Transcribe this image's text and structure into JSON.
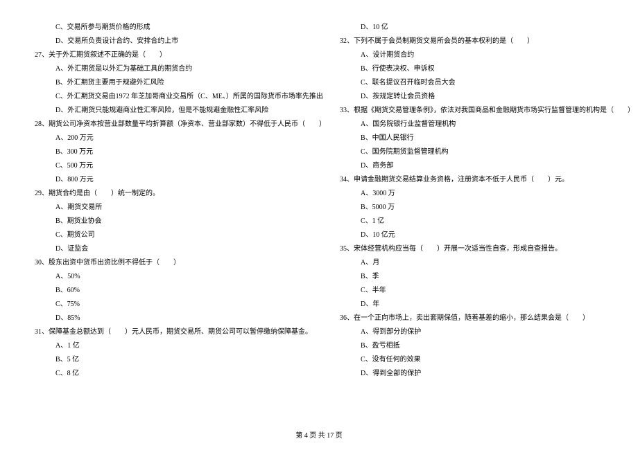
{
  "left_lines": [
    {
      "cls": "opt-indent",
      "text": "C、交易所参与期货价格的形成"
    },
    {
      "cls": "opt-indent",
      "text": "D、交易所负责设计合约、安排合约上市"
    },
    {
      "cls": "q-indent",
      "text": "27、关于外汇期货叙述不正确的是（　　）"
    },
    {
      "cls": "opt-indent",
      "text": "A、外汇期货是以外汇为基础工具的期货合约"
    },
    {
      "cls": "opt-indent",
      "text": "B、外汇期货主要用于规避外汇风险"
    },
    {
      "cls": "opt-indent",
      "text": "C、外汇期货交易由1972 年芝加哥商业交易所（C、ME、）所属的国际货币市场率先推出"
    },
    {
      "cls": "opt-indent",
      "text": "D、外汇期货只能规避商业性汇率风险，但是不能规避金融性汇率风险"
    },
    {
      "cls": "q-indent",
      "text": "28、期货公司净资本按营业部数量平均折算额（净资本、营业部家数）不得低于人民币（　　）"
    },
    {
      "cls": "opt-indent",
      "text": "A、200 万元"
    },
    {
      "cls": "opt-indent",
      "text": "B、300 万元"
    },
    {
      "cls": "opt-indent",
      "text": "C、500 万元"
    },
    {
      "cls": "opt-indent",
      "text": "D、800 万元"
    },
    {
      "cls": "q-indent",
      "text": "29、期货合约是由（　　）统一制定的。"
    },
    {
      "cls": "opt-indent",
      "text": "A、期货交易所"
    },
    {
      "cls": "opt-indent",
      "text": "B、期货业协会"
    },
    {
      "cls": "opt-indent",
      "text": "C、期货公司"
    },
    {
      "cls": "opt-indent",
      "text": "D、证监会"
    },
    {
      "cls": "q-indent",
      "text": "30、股东出资中货币出资比例不得低于（　　）"
    },
    {
      "cls": "opt-indent",
      "text": "A、50%"
    },
    {
      "cls": "opt-indent",
      "text": "B、60%"
    },
    {
      "cls": "opt-indent",
      "text": "C、75%"
    },
    {
      "cls": "opt-indent",
      "text": "D、85%"
    },
    {
      "cls": "q-indent",
      "text": "31、保障基金总额达到（　　）元人民币，期货交易所、期货公司可以暂停缴纳保障基金。"
    },
    {
      "cls": "opt-indent",
      "text": "A、1 亿"
    },
    {
      "cls": "opt-indent",
      "text": "B、5 亿"
    },
    {
      "cls": "opt-indent",
      "text": "C、8 亿"
    }
  ],
  "right_lines": [
    {
      "cls": "opt-indent",
      "text": "D、10 亿"
    },
    {
      "cls": "q-indent",
      "text": "32、下列不属于会员制期货交易所会员的基本权利的是（　　）"
    },
    {
      "cls": "opt-indent",
      "text": "A、设计期货合约"
    },
    {
      "cls": "opt-indent",
      "text": "B、行使表决权、申诉权"
    },
    {
      "cls": "opt-indent",
      "text": "C、联名提议召开临时会员大会"
    },
    {
      "cls": "opt-indent",
      "text": "D、按规定转让会员资格"
    },
    {
      "cls": "q-indent",
      "text": "33、根据《期货交易管理条例》，依法对我国商品和金融期货市场实行监督管理的机构是（　　）"
    },
    {
      "cls": "opt-indent",
      "text": "A、国务院银行业监督管理机构"
    },
    {
      "cls": "opt-indent",
      "text": "B、中国人民银行"
    },
    {
      "cls": "opt-indent",
      "text": "C、国务院期货监督管理机构"
    },
    {
      "cls": "opt-indent",
      "text": "D、商务部"
    },
    {
      "cls": "q-indent",
      "text": "34、申请金融期货交易结算业务资格，注册资本不低于人民币（　　）元。"
    },
    {
      "cls": "opt-indent",
      "text": "A、3000 万"
    },
    {
      "cls": "opt-indent",
      "text": "B、5000 万"
    },
    {
      "cls": "opt-indent",
      "text": "C、1 亿"
    },
    {
      "cls": "opt-indent",
      "text": "D、10 亿元"
    },
    {
      "cls": "q-indent",
      "text": "35、宋体经营机构应当每（　　）开展一次适当性自查，形成自查报告。"
    },
    {
      "cls": "opt-indent",
      "text": "A、月"
    },
    {
      "cls": "opt-indent",
      "text": "B、季"
    },
    {
      "cls": "opt-indent",
      "text": "C、半年"
    },
    {
      "cls": "opt-indent",
      "text": "D、年"
    },
    {
      "cls": "q-indent",
      "text": "36、在一个正向市场上，卖出套期保值，随着基差的缩小，那么结果会是（　　）"
    },
    {
      "cls": "opt-indent",
      "text": "A、得到部分的保护"
    },
    {
      "cls": "opt-indent",
      "text": "B、盈亏相抵"
    },
    {
      "cls": "opt-indent",
      "text": "C、没有任何的效果"
    },
    {
      "cls": "opt-indent",
      "text": "D、得到全部的保护"
    }
  ],
  "footer": "第 4 页 共 17 页"
}
